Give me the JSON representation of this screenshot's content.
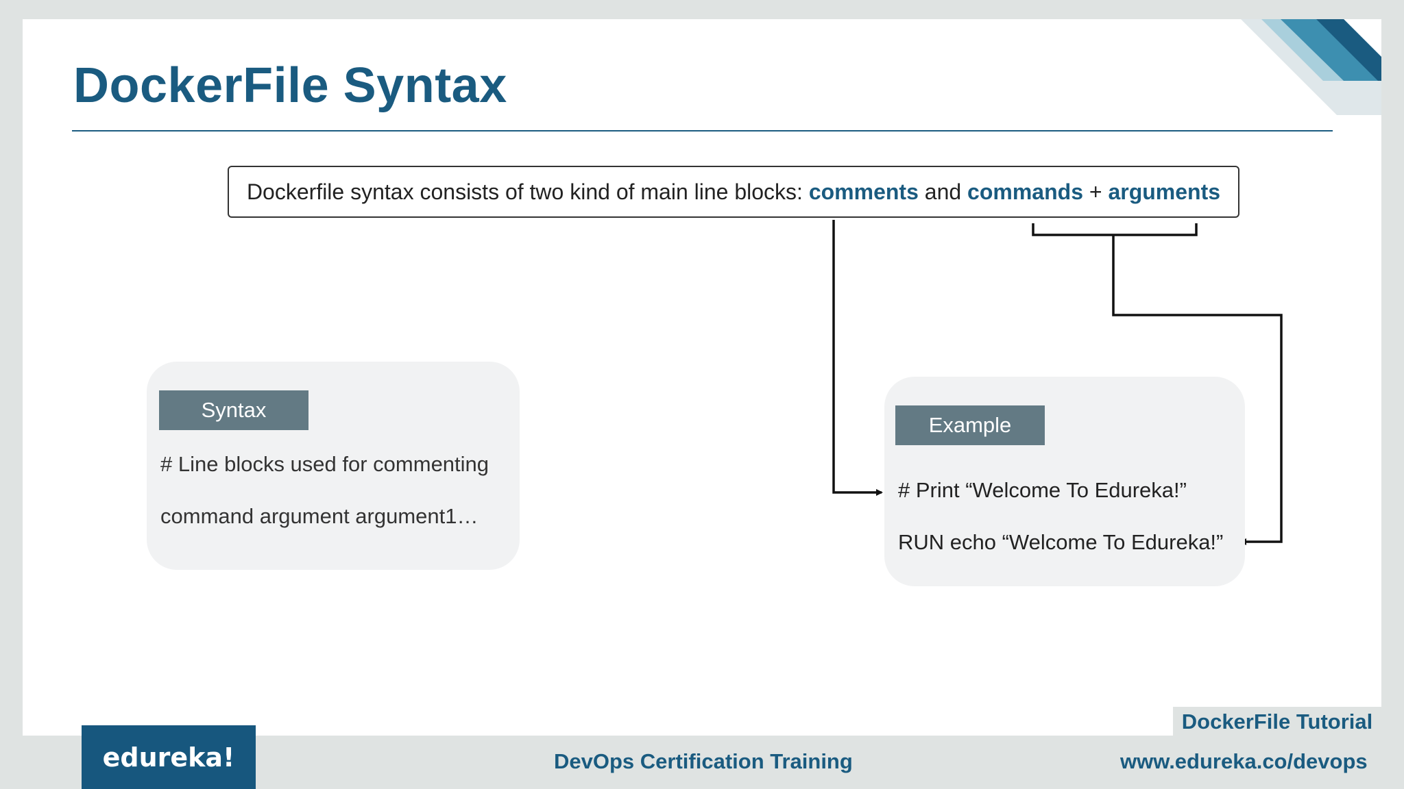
{
  "slide": {
    "title": "DockerFile Syntax",
    "intro": {
      "prefix": "Dockerfile syntax consists of two kind of main line blocks: ",
      "kw_comments": "comments",
      "and": " and ",
      "kw_commands": "commands",
      "plus": " + ",
      "kw_arguments": "arguments"
    },
    "syntax_card": {
      "label": "Syntax",
      "line1": "# Line blocks used for commenting",
      "line2": "command argument argument1…"
    },
    "example_card": {
      "label": "Example",
      "line1": "# Print “Welcome To Edureka!”",
      "line2": "RUN echo “Welcome To Edureka!”"
    }
  },
  "footer": {
    "tag": "DockerFile Tutorial",
    "logo": "edureka!",
    "center": "DevOps Certification Training",
    "url": "www.edureka.co/devops"
  },
  "colors": {
    "accent": "#1a5b80",
    "label_bg": "#637a84",
    "card_bg": "#f1f2f3",
    "frame": "#dfe3e2"
  }
}
